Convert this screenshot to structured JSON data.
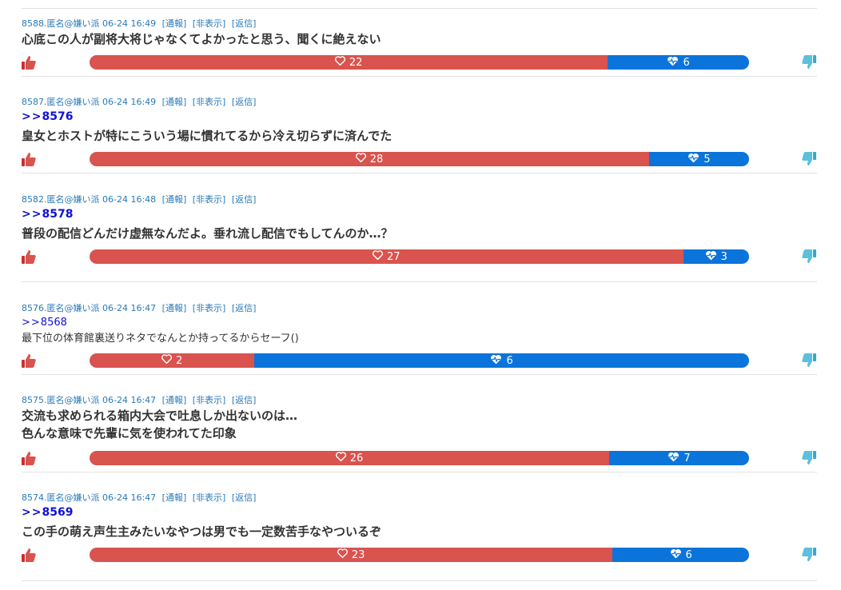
{
  "links": {
    "report": "[通報]",
    "hide": "[非表示]",
    "reply": "[返信]"
  },
  "colors": {
    "like": "#d9534f",
    "dislike": "#0a74da",
    "meta": "#2a7ab8",
    "anchor": "#1010d8"
  },
  "posts": [
    {
      "header": "8588.匿名@嫌い派 06-24 16:49",
      "anchor": "",
      "lines": [
        "心底この人が副将大将じゃなくてよかったと思う、聞くに絶えない"
      ],
      "bold": true,
      "likes": 22,
      "dislikes": 6
    },
    {
      "header": "8587.匿名@嫌い派 06-24 16:49",
      "anchor": "8576",
      "lines": [
        "皇女とホストが特にこういう場に慣れてるから冷え切らずに済んでた"
      ],
      "bold": true,
      "likes": 28,
      "dislikes": 5
    },
    {
      "header": "8582.匿名@嫌い派 06-24 16:48",
      "anchor": "8578",
      "lines": [
        "普段の配信どんだけ虚無なんだよ。垂れ流し配信でもしてんのか…？"
      ],
      "bold": true,
      "likes": 27,
      "dislikes": 3
    },
    {
      "header": "8576.匿名@嫌い派 06-24 16:47",
      "anchor": "8568",
      "lines": [
        "最下位の体育館裏送りネタでなんとか持ってるからセーフ()"
      ],
      "bold": false,
      "likes": 2,
      "dislikes": 6
    },
    {
      "header": "8575.匿名@嫌い派 06-24 16:47",
      "anchor": "",
      "lines": [
        "交流も求められる箱内大会で吐息しか出ないのは…",
        "色んな意味で先輩に気を使われてた印象"
      ],
      "bold": true,
      "likes": 26,
      "dislikes": 7
    },
    {
      "header": "8574.匿名@嫌い派 06-24 16:47",
      "anchor": "8569",
      "lines": [
        "この手の萌え声生主みたいなやつは男でも一定数苦手なやついるぞ"
      ],
      "bold": true,
      "likes": 23,
      "dislikes": 6
    }
  ]
}
